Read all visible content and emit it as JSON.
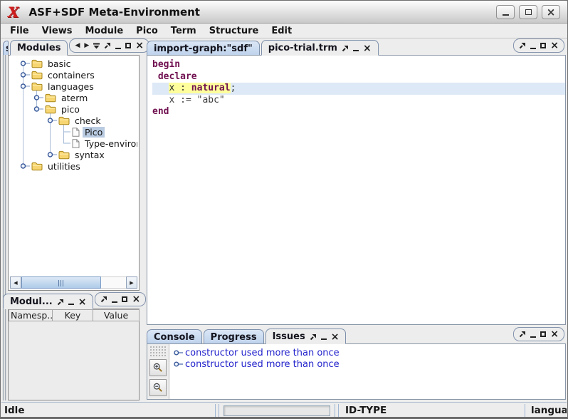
{
  "window": {
    "title": "ASF+SDF Meta-Environment"
  },
  "menu": {
    "items": [
      "File",
      "Views",
      "Module",
      "Pico",
      "Term",
      "Structure",
      "Edit"
    ]
  },
  "modules_panel": {
    "clipped_tab_label": "s",
    "tab_label": "Modules",
    "tree": [
      {
        "label": "basic",
        "level": 0,
        "kind": "folder",
        "expanded": false
      },
      {
        "label": "containers",
        "level": 0,
        "kind": "folder",
        "expanded": false
      },
      {
        "label": "languages",
        "level": 0,
        "kind": "folder",
        "expanded": true
      },
      {
        "label": "aterm",
        "level": 1,
        "kind": "folder",
        "expanded": false
      },
      {
        "label": "pico",
        "level": 1,
        "kind": "folder",
        "expanded": true
      },
      {
        "label": "check",
        "level": 2,
        "kind": "folder",
        "expanded": true
      },
      {
        "label": "Pico",
        "level": 3,
        "kind": "file",
        "selected": true
      },
      {
        "label": "Type-environn",
        "level": 3,
        "kind": "file"
      },
      {
        "label": "syntax",
        "level": 2,
        "kind": "folder",
        "expanded": false
      },
      {
        "label": "utilities",
        "level": 0,
        "kind": "folder",
        "expanded": false
      }
    ]
  },
  "namespace_panel": {
    "tab_label": "Modul...",
    "columns": [
      "Namesp...",
      "Key",
      "Value"
    ]
  },
  "editor": {
    "tabs": [
      {
        "label": "import-graph:\"sdf\"",
        "selected": false,
        "controls": false
      },
      {
        "label": "pico-trial.trm",
        "selected": true,
        "controls": true
      }
    ],
    "code": {
      "lines": [
        {
          "segments": [
            {
              "text": "begin",
              "style": "keyword"
            }
          ]
        },
        {
          "segments": [
            {
              "text": " ",
              "style": "plain"
            },
            {
              "text": "declare",
              "style": "keyword"
            }
          ]
        },
        {
          "current": true,
          "segments": [
            {
              "text": "   ",
              "style": "plain"
            },
            {
              "text": "x : ",
              "style": "highlight"
            },
            {
              "text": "natural",
              "style": "highlight-keyword"
            },
            {
              "text": ";",
              "style": "plain"
            }
          ]
        },
        {
          "segments": [
            {
              "text": "   ",
              "style": "plain"
            },
            {
              "text": "x := \"abc\"",
              "style": "plain"
            }
          ]
        },
        {
          "segments": [
            {
              "text": "end",
              "style": "keyword"
            }
          ]
        }
      ]
    }
  },
  "console_panel": {
    "tabs": [
      {
        "label": "Console",
        "selected": false,
        "controls": false
      },
      {
        "label": "Progress",
        "selected": false,
        "controls": false
      },
      {
        "label": "Issues",
        "selected": true,
        "controls": true
      }
    ],
    "issues": [
      "constructor used more than once",
      "constructor used more than once"
    ]
  },
  "statusbar": {
    "mode": "Idle",
    "center_label": "ID-TYPE",
    "right_label": "langua"
  },
  "colors": {
    "keyword": "#701050",
    "issue_text": "#2222cc",
    "highlight": "#feff9c",
    "current_line": "#dde9f6",
    "tree_selection": "#b9cbe1"
  }
}
